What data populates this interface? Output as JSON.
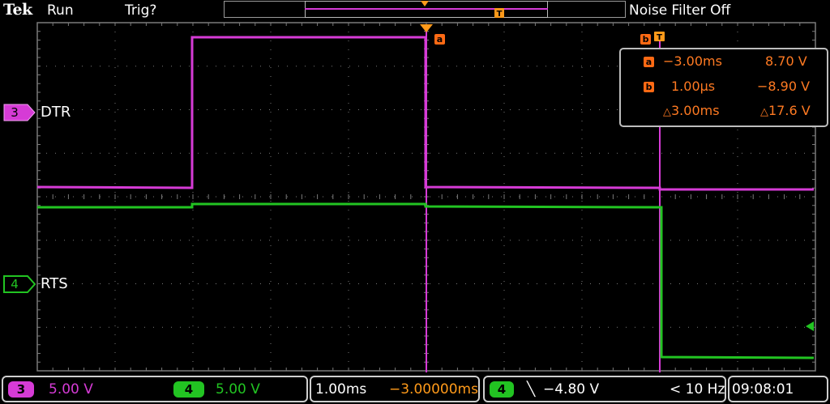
{
  "header": {
    "brand": "Tek",
    "status": "Run",
    "trigger_state": "Trig?",
    "noise_filter": "Noise Filter Off"
  },
  "channels": [
    {
      "number": "3",
      "name": "DTR",
      "scale": "5.00 V",
      "color": "#d63bd6"
    },
    {
      "number": "4",
      "name": "RTS",
      "scale": "5.00 V",
      "color": "#22c422"
    }
  ],
  "cursor_readout": {
    "a_label": "a",
    "a_time": "−3.00ms",
    "a_volt": "8.70 V",
    "b_label": "b",
    "b_time": "1.00µs",
    "b_volt": "−8.90 V",
    "delta_time": "3.00ms",
    "delta_volt": "17.6 V"
  },
  "timebase": {
    "scale": "1.00ms",
    "position": "−3.00000ms"
  },
  "trigger": {
    "source": "4",
    "slope": "╲",
    "level": "−4.80 V",
    "frequency": "< 10 Hz"
  },
  "clock": "09:08:01",
  "colors": {
    "ch3": "#d63bd6",
    "ch4": "#22c422",
    "cursor": "#ff7a22",
    "grid": "#7a7a7a"
  }
}
